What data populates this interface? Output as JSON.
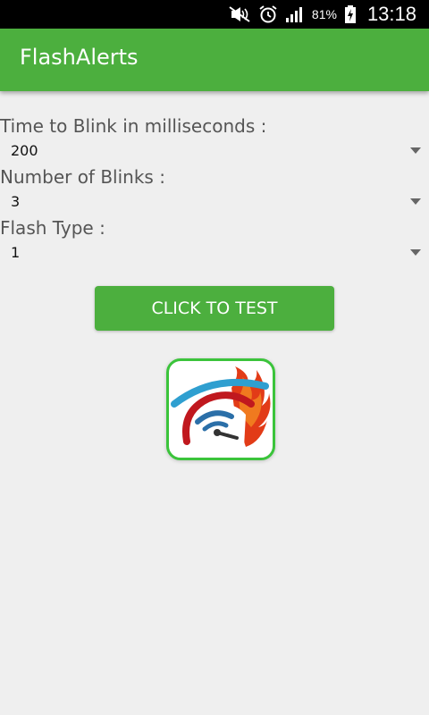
{
  "status_bar": {
    "battery_percent": "81%",
    "time": "13:18",
    "icons": [
      "mute-icon",
      "alarm-icon",
      "signal-icon",
      "battery-charging-icon"
    ]
  },
  "app_bar": {
    "title": "FlashAlerts",
    "color": "#4caf3e"
  },
  "form": {
    "blink_time": {
      "label": "Time to Blink in milliseconds :",
      "value": "200"
    },
    "blinks": {
      "label": "Number of Blinks :",
      "value": "3"
    },
    "flash_type": {
      "label": "Flash Type :",
      "value": "1"
    }
  },
  "test_button": {
    "label": "CLICK TO TEST"
  },
  "logo": {
    "icon": "flash-speedometer-logo-icon"
  }
}
